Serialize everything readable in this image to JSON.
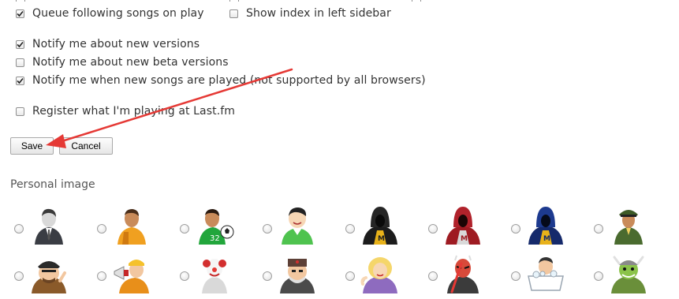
{
  "options": {
    "queue_following": {
      "label": "Queue following songs on play",
      "checked": true
    },
    "show_index": {
      "label": "Show index in left sidebar",
      "checked": false
    },
    "notify_versions": {
      "label": "Notify me about new versions",
      "checked": true
    },
    "notify_beta": {
      "label": "Notify me about new beta versions",
      "checked": false
    },
    "notify_songs": {
      "label": "Notify me when new songs are played (not supported by all browsers)",
      "checked": true
    },
    "register_lastfm": {
      "label": "Register what I'm playing at Last.fm",
      "checked": false
    }
  },
  "buttons": {
    "save": "Save",
    "cancel": "Cancel"
  },
  "personal_image": {
    "title": "Personal image",
    "avatars": [
      "businessman-avatar-icon",
      "worker-avatar-icon",
      "football-player-avatar-icon",
      "smiling-boy-avatar-icon",
      "hooded-figure-yellow-avatar-icon",
      "hooded-figure-red-avatar-icon",
      "hooded-figure-blue-avatar-icon",
      "soldier-avatar-icon",
      "pirate-avatar-icon",
      "megaphone-builder-avatar-icon",
      "clown-avatar-icon",
      "russian-officer-avatar-icon",
      "blonde-woman-avatar-icon",
      "sith-lightsaber-avatar-icon",
      "bathtub-man-avatar-icon",
      "viking-avatar-icon"
    ]
  },
  "annotation": {
    "arrow_color": "#e53935"
  }
}
